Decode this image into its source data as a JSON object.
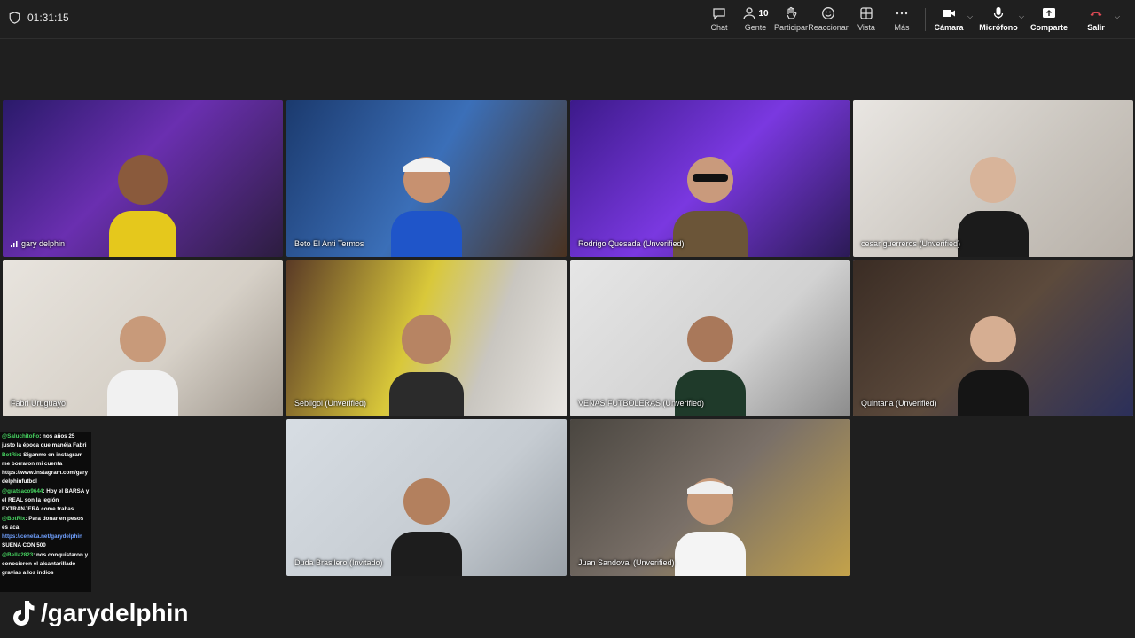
{
  "timer": "01:31:15",
  "toolbar": {
    "chat": "Chat",
    "people": "Gente",
    "people_count": "10",
    "raise": "Participar",
    "react": "Reaccionar",
    "view": "Vista",
    "more": "Más",
    "camera": "Cámara",
    "mic": "Micrófono",
    "share": "Comparte",
    "leave": "Salir"
  },
  "participants": [
    {
      "name": "gary delphin"
    },
    {
      "name": "Beto El Anti Termos"
    },
    {
      "name": "Rodrigo Quesada (Unverified)"
    },
    {
      "name": "cesar guerreros (Unverified)"
    },
    {
      "name": "Fabri Uruguayo"
    },
    {
      "name": "Sebiigol (Unverified)"
    },
    {
      "name": "VENAS FUTBOLERAS (Unverified)"
    },
    {
      "name": "Quintana (Unverified)"
    },
    {
      "name": "Duda Brasilero (Invitado)"
    },
    {
      "name": "Juan Sandoval (Unverified)"
    }
  ],
  "chat": {
    "m1_user": "@SaluchitoFo",
    "m1_text": ": nos años 25 justo la época que manéja Fabri",
    "m2_user": "BotRix",
    "m2_text": ": Síganme en instagram me borraron mi cuenta",
    "m2_link": "https://www.instagram.com/garydelphinfutbol",
    "m3_user": "@gratsaco9644",
    "m3_text": ": Hoy el BARSA y el REAL son la legión EXTRANJERA come trabas",
    "m4_user": "@BotRix",
    "m4_text": ": Para donar en pesos es aca",
    "m4_link": "https://ceneka.net/garydelphin",
    "m4_text2": "SUENA CON 500",
    "m5_user": "@Bella2823",
    "m5_text": ": nos conquistaron y conocieron el alcantarillado gravias a los indios"
  },
  "brand": "/garydelphin",
  "colors": {
    "background": "#1f1f1f",
    "active_border": "#b9a7f2",
    "leave_red": "#e04a55",
    "chat_user_green": "#47d461"
  }
}
